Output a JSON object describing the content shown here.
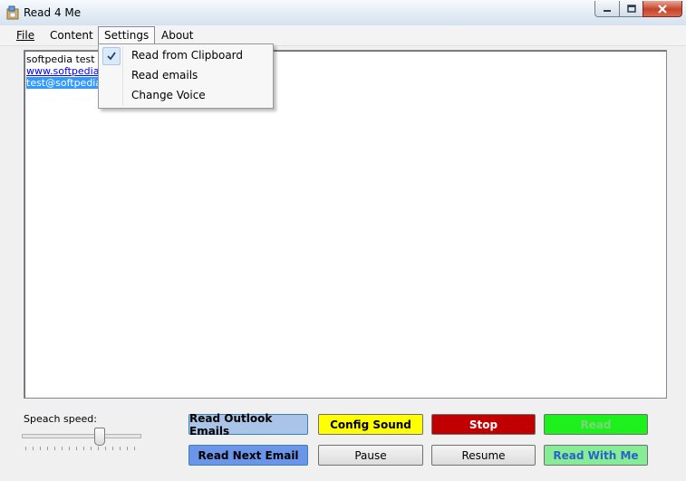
{
  "window": {
    "title": "Read 4 Me",
    "icon": "app-icon"
  },
  "menubar": {
    "items": [
      {
        "label": "File",
        "mnemonic": "F",
        "rest": "ile"
      },
      {
        "label": "Content"
      },
      {
        "label": "Settings"
      },
      {
        "label": "About"
      }
    ]
  },
  "settings_menu": {
    "items": [
      {
        "label": "Read from Clipboard",
        "checked": true
      },
      {
        "label": "Read emails",
        "checked": false
      },
      {
        "label": "Change Voice",
        "checked": false
      }
    ]
  },
  "text_area": {
    "lines": [
      "softpedia test",
      "www.softpedia.c",
      "test@softpedia.c"
    ]
  },
  "speed": {
    "label": "Speach speed:",
    "level_fraction": 0.65
  },
  "buttons": {
    "read_outlook_emails": "Read Outlook Emails",
    "config_sound": "Config Sound",
    "stop": "Stop",
    "read": "Read",
    "read_next_email": "Read Next Email",
    "pause": "Pause",
    "resume": "Resume",
    "read_with_me": "Read With Me"
  },
  "colors": {
    "read_outlook_bg": "#a9c4e6",
    "config_sound_bg": "#ffff00",
    "stop_bg": "#c00000",
    "read_bg": "#1ef01e",
    "read_next_bg": "#6b95e8",
    "read_with_me_bg": "#86ec96",
    "selection": "#3399ff"
  }
}
